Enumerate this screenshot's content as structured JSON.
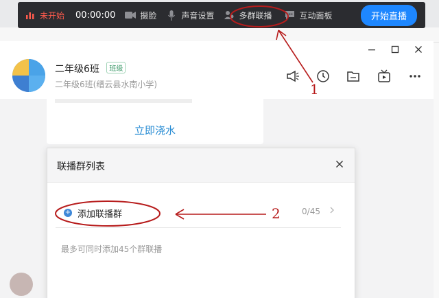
{
  "toolbar": {
    "status": "未开始",
    "timer": "00:00:00",
    "camera": "摄脸",
    "sound": "声音设置",
    "multi": "多群联播",
    "interact": "互动面板",
    "start": "开始直播"
  },
  "group": {
    "name": "二年级6班",
    "tag": "班级",
    "subtitle": "二年级6班(缙云县水南小学)"
  },
  "card": {
    "link": "立即浇水"
  },
  "dialog": {
    "title": "联播群列表",
    "add_label": "添加联播群",
    "count": "0/45",
    "hint": "最多可同时添加45个群联播"
  },
  "annotations": {
    "label1": "1",
    "label2": "2"
  },
  "colors": {
    "toolbar_bg": "#2b2c30",
    "accent": "#1e87ff",
    "annotation": "#b71c1c"
  }
}
